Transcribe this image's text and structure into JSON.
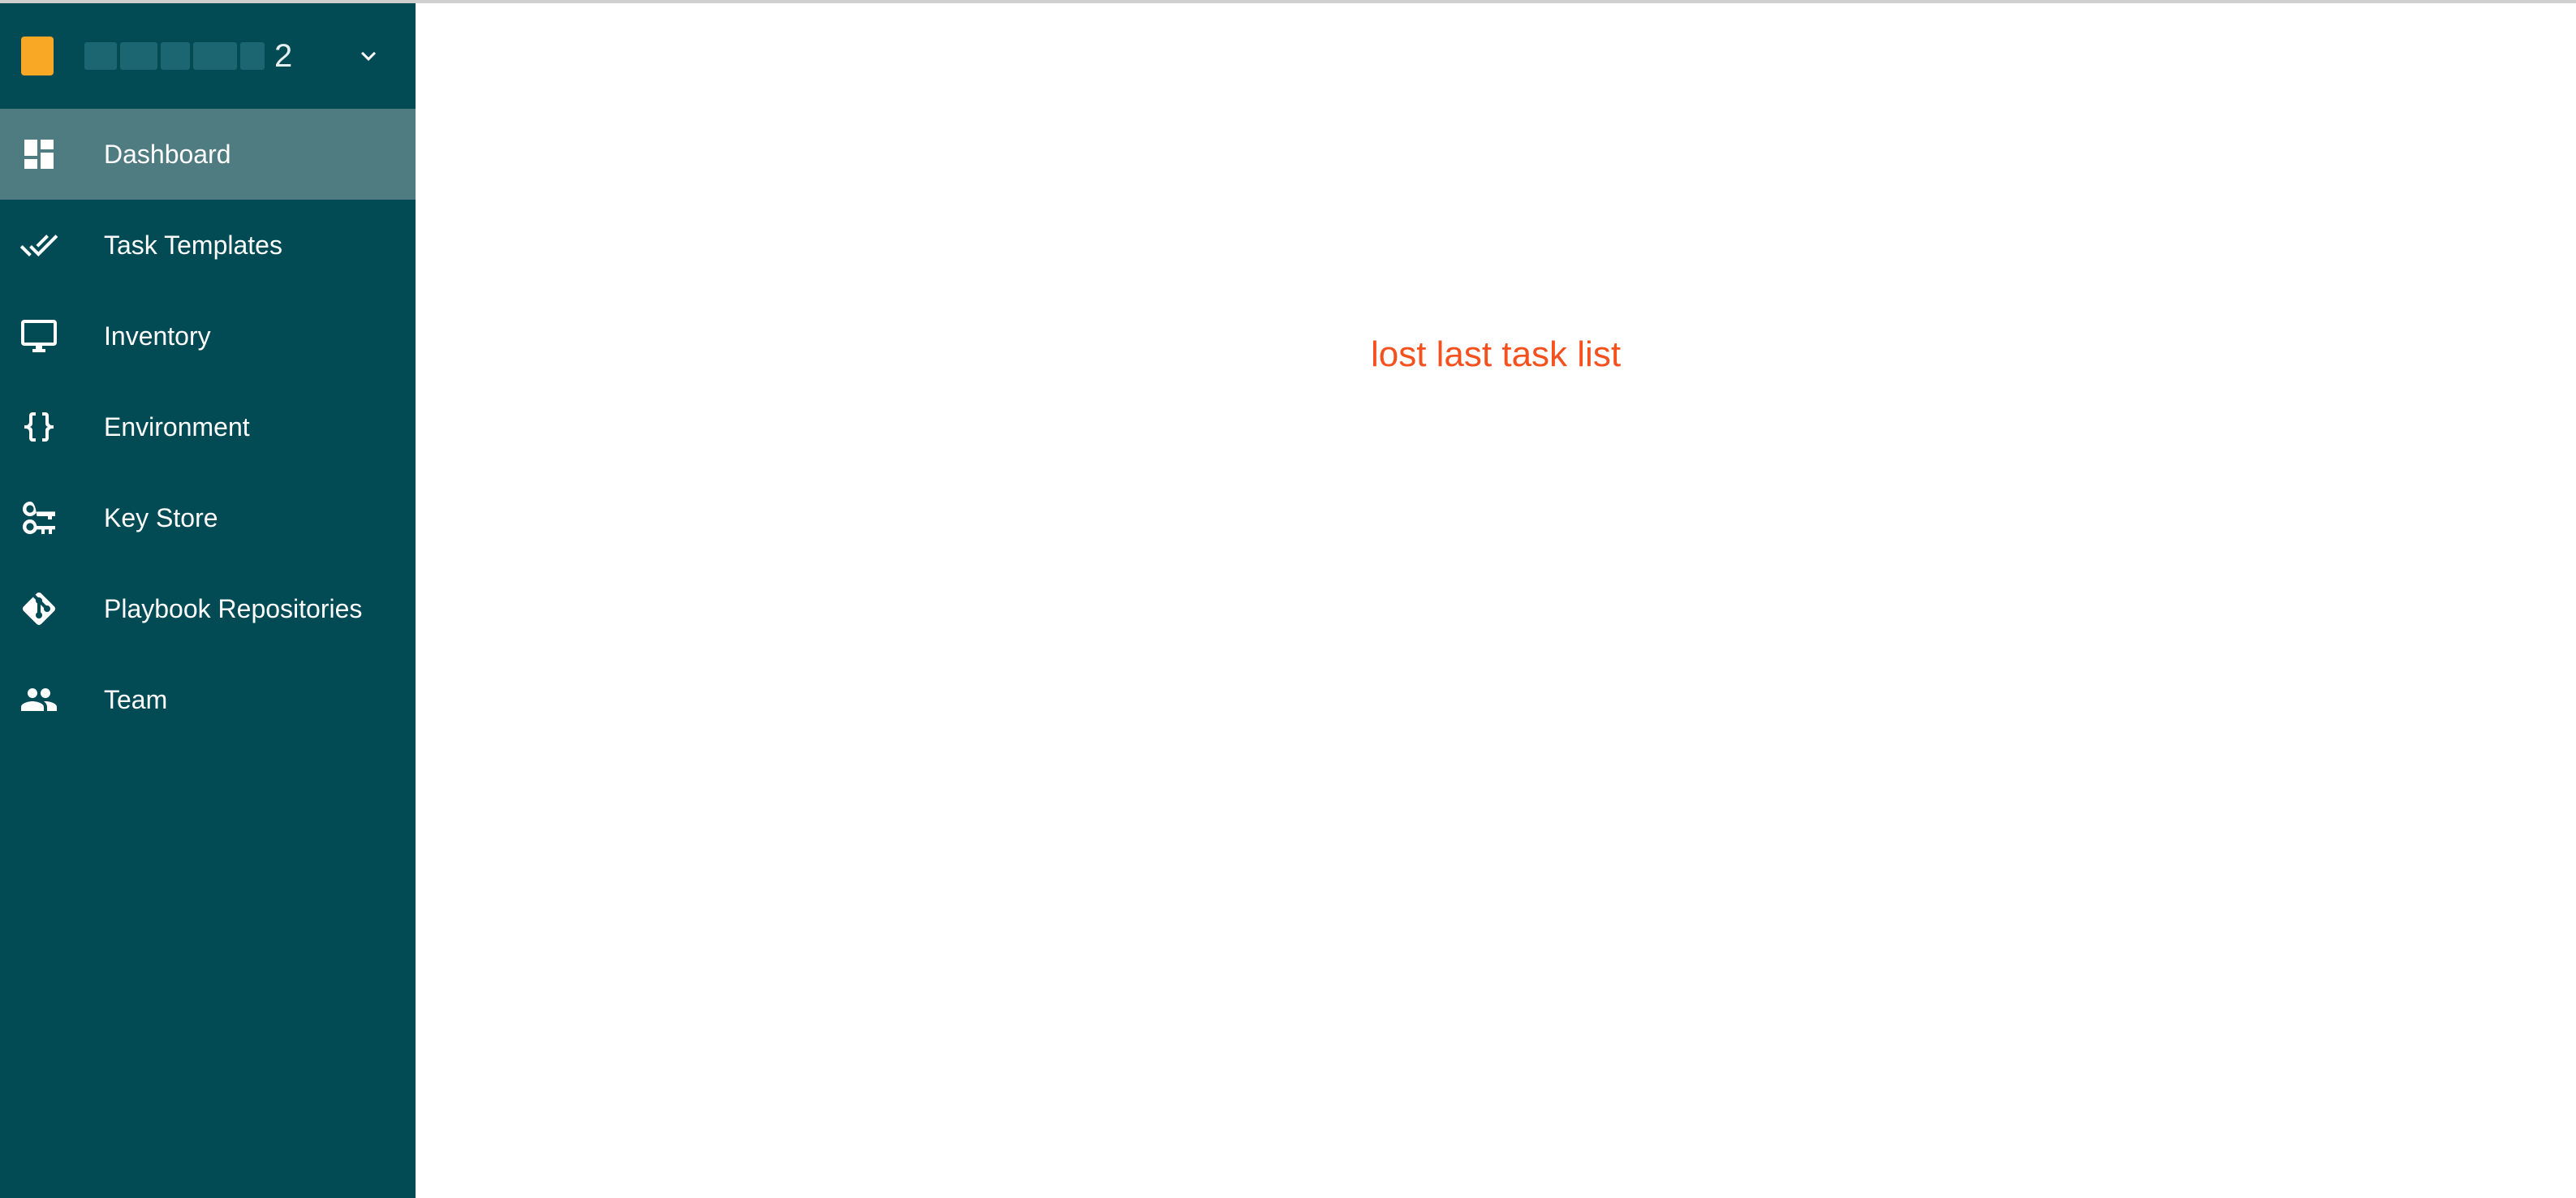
{
  "project": {
    "name": "2",
    "icon": "project-square-icon",
    "icon_color": "#f9a825"
  },
  "sidebar": {
    "background": "#024b55",
    "active_background": "#4f7c81",
    "items": [
      {
        "label": "Dashboard",
        "icon": "dashboard-icon",
        "active": true
      },
      {
        "label": "Task Templates",
        "icon": "double-check-icon",
        "active": false
      },
      {
        "label": "Inventory",
        "icon": "monitor-icon",
        "active": false
      },
      {
        "label": "Environment",
        "icon": "braces-icon",
        "active": false
      },
      {
        "label": "Key Store",
        "icon": "key-icon",
        "active": false
      },
      {
        "label": "Playbook Repositories",
        "icon": "git-icon",
        "active": false
      },
      {
        "label": "Team",
        "icon": "team-icon",
        "active": false
      }
    ]
  },
  "main": {
    "message": "lost last task list",
    "message_color": "#f4511e"
  }
}
